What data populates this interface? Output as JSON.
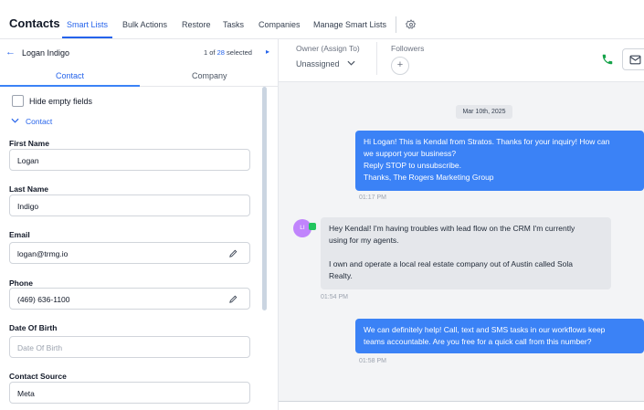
{
  "topnav": {
    "title": "Contacts",
    "items": [
      "Smart Lists",
      "Bulk Actions",
      "Restore",
      "Tasks",
      "Companies",
      "Manage Smart Lists"
    ]
  },
  "contact_header": {
    "name": "Logan Indigo",
    "pager_prefix": "1 of",
    "pager_count": "28",
    "pager_suffix": "selected"
  },
  "tabs": [
    "Contact",
    "Company"
  ],
  "hide_empty_label": "Hide empty fields",
  "section_label": "Contact",
  "fields": [
    {
      "label": "First Name",
      "value": "Logan",
      "placeholder": ""
    },
    {
      "label": "Last Name",
      "value": "Indigo",
      "placeholder": ""
    },
    {
      "label": "Email",
      "value": "logan@trmg.io",
      "placeholder": ""
    },
    {
      "label": "Phone",
      "value": "(469) 636-1100",
      "placeholder": ""
    },
    {
      "label": "Date Of Birth",
      "value": "",
      "placeholder": "Date Of Birth"
    },
    {
      "label": "Contact Source",
      "value": "Meta",
      "placeholder": ""
    }
  ],
  "owner": {
    "label": "Owner (Assign To)",
    "value": "Unassigned"
  },
  "followers": {
    "label": "Followers",
    "add_symbol": "+"
  },
  "conversation": {
    "date": "Mar 10th, 2025",
    "messages": [
      {
        "direction": "outbound",
        "lines": [
          "Hi Logan! This is Kendal from Stratos. Thanks for your inquiry! How can",
          "we support your business?",
          "Reply STOP to unsubscribe.",
          "Thanks, The Rogers Marketing Group"
        ],
        "time": "01:17 PM"
      },
      {
        "direction": "inbound",
        "avatar": "LI",
        "lines": [
          "Hey Kendal! I'm having troubles with lead flow on the CRM I'm currently",
          "using for my agents.",
          "",
          "I own and operate a local real estate company out of Austin called Sola",
          "Realty."
        ],
        "time": "01:54 PM"
      },
      {
        "direction": "outbound",
        "lines": [
          "We can definitely help! Call, text and SMS tasks in our workflows keep",
          "teams accountable. Are you free for a quick call from this number?"
        ],
        "time": "01:58 PM"
      }
    ]
  },
  "colors": {
    "accent": "#2563eb",
    "bubble_out": "#3b82f6",
    "bubble_in": "#e5e7eb",
    "phone_green": "#16a34a"
  }
}
